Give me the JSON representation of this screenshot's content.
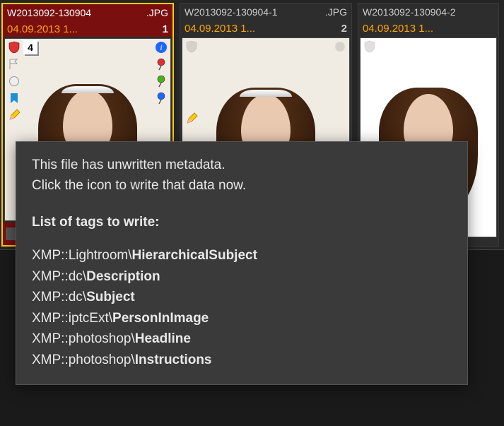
{
  "tooltip": {
    "line1": "This file has unwritten metadata.",
    "line2": "Click the icon to write that data now.",
    "heading": "List of tags to write:",
    "tags": [
      {
        "ns": "XMP::Lightroom",
        "name": "HierarchicalSubject"
      },
      {
        "ns": "XMP::dc",
        "name": "Description"
      },
      {
        "ns": "XMP::dc",
        "name": "Subject"
      },
      {
        "ns": "XMP::iptcExt",
        "name": "PersonInImage"
      },
      {
        "ns": "XMP::photoshop",
        "name": "Headline"
      },
      {
        "ns": "XMP::photoshop",
        "name": "Instructions"
      }
    ]
  },
  "thumbs": [
    {
      "filename": "W2013092-130904",
      "ext": ".JPG",
      "date": "04.09.2013 1...",
      "num": "1",
      "stack": "4",
      "selected": true
    },
    {
      "filename": "W2013092-130904-1",
      "ext": ".JPG",
      "date": "04.09.2013 1...",
      "num": "2",
      "selected": false
    },
    {
      "filename": "W2013092-130904-2",
      "ext": "",
      "date": "04.09.2013 1...",
      "num": "",
      "selected": false
    }
  ],
  "icons": {
    "shield": "shield-icon",
    "flag": "flag-icon",
    "circle": "circle-icon",
    "bookmark": "bookmark-icon",
    "pencil": "pencil-icon",
    "info": "info-icon",
    "pinRed": "pin-red-icon",
    "pinGreen": "pin-green-icon",
    "pinBlue": "pin-blue-icon"
  }
}
